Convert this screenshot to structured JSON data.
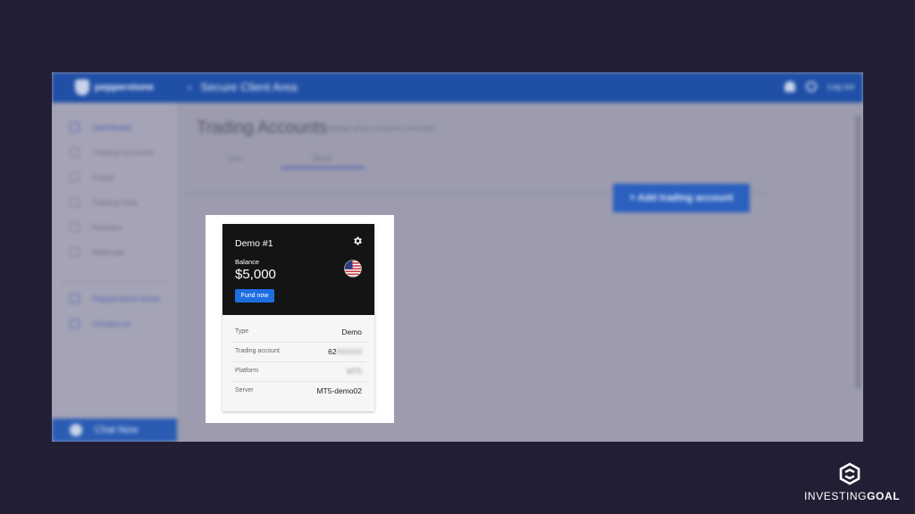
{
  "app": {
    "brand": "pepperstone",
    "breadcrumb": "Secure Client Area",
    "topbar_right": "Log out",
    "page_title": "Trading Accounts",
    "page_subtitle": "Manage all your accounts in one place",
    "tabs": [
      "Live",
      "Demo"
    ],
    "active_tab": "Demo",
    "add_button": "+  Add trading account",
    "sidebar": {
      "items": [
        {
          "label": "Dashboard",
          "icon": "dashboard-icon",
          "active": true
        },
        {
          "label": "Trading accounts",
          "icon": "accounts-icon",
          "active": false
        },
        {
          "label": "Funds",
          "icon": "wallet-icon",
          "active": false
        },
        {
          "label": "Trading tools",
          "icon": "tools-icon",
          "active": false
        },
        {
          "label": "Partners",
          "icon": "partners-icon",
          "active": false
        },
        {
          "label": "Referrals",
          "icon": "referrals-icon",
          "active": false
        },
        {
          "label": "Pepperstone home",
          "icon": "home-icon",
          "active": false
        },
        {
          "label": "Contact us",
          "icon": "contact-icon",
          "active": false
        }
      ],
      "chat_button": "Chat Now"
    }
  },
  "card": {
    "name": "Demo #1",
    "balance_label": "Balance",
    "balance_value": "$5,000",
    "fund_button": "Fund now",
    "rows": [
      {
        "key": "Type",
        "value": "Demo",
        "blurred": false
      },
      {
        "key": "Trading account",
        "value": "62",
        "hidden_value": "XXXXX",
        "blurred": true
      },
      {
        "key": "Platform",
        "value": "MT5",
        "blurred": true
      },
      {
        "key": "Server",
        "value": "MT5-demo02",
        "blurred": false
      }
    ],
    "currency_flag": "us-flag-icon"
  },
  "watermark": {
    "text_regular": "INVESTING",
    "text_bold": "GOAL"
  },
  "colors": {
    "page_bg": "#221f35",
    "topbar": "#1f4fa6",
    "card_head": "#141414",
    "fund_button": "#1d6fe0"
  }
}
